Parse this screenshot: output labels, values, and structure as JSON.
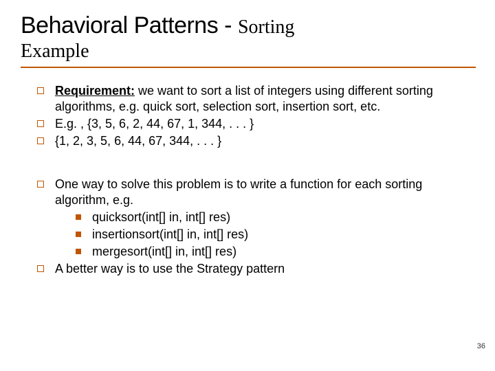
{
  "title": {
    "main": "Behavioral Patterns - ",
    "sub": "Sorting",
    "line2": "Example"
  },
  "group1": {
    "item1_label": "Requirement:",
    "item1_text": " we want to sort a list of integers using different sorting algorithms, e.g. quick sort, selection sort, insertion sort, etc.",
    "item2": "E.g. , {3, 5, 6, 2, 44, 67, 1, 344, . . . }",
    "item3": "{1, 2, 3, 5, 6, 44, 67, 344, . . . }"
  },
  "group2": {
    "item1": "One way to solve this problem is to write a function for each sorting algorithm, e.g.",
    "sub": {
      "a": "quicksort(int[] in, int[] res)",
      "b": "insertionsort(int[] in, int[] res)",
      "c": "mergesort(int[] in, int[] res)"
    },
    "item2": "A better way is to use the Strategy pattern"
  },
  "page_number": "36"
}
